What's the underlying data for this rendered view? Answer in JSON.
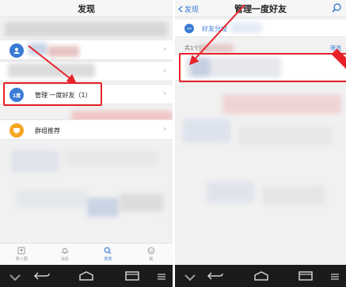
{
  "left": {
    "title": "发现",
    "items": [
      {
        "label": "",
        "icon": "contacts-icon",
        "color": "#3a7bd5"
      },
      {
        "label": "",
        "icon": "unknown-icon",
        "color": "#dddddd"
      },
      {
        "label": "管理 一度好友（1）",
        "icon": "one-degree-icon",
        "badge": "1度",
        "color": "#3a7bd5"
      },
      {
        "label": "群组推荐",
        "icon": "group-recommend-icon",
        "color": "#f5a623"
      }
    ],
    "tabs": [
      {
        "label": "熟人圈",
        "icon": "circle-icon"
      },
      {
        "label": "消息",
        "icon": "bell-icon"
      },
      {
        "label": "发现",
        "icon": "discover-icon",
        "active": true
      },
      {
        "label": "我",
        "icon": "me-icon"
      }
    ]
  },
  "right": {
    "back_label": "发现",
    "title": "管理一度好友",
    "group_label": "好友分组 （1）",
    "count_text": "共1个好友",
    "filter_label": "筛选"
  },
  "colors": {
    "accent": "#3a7bd5",
    "highlight": "#e8222a",
    "orange": "#f5a623"
  }
}
